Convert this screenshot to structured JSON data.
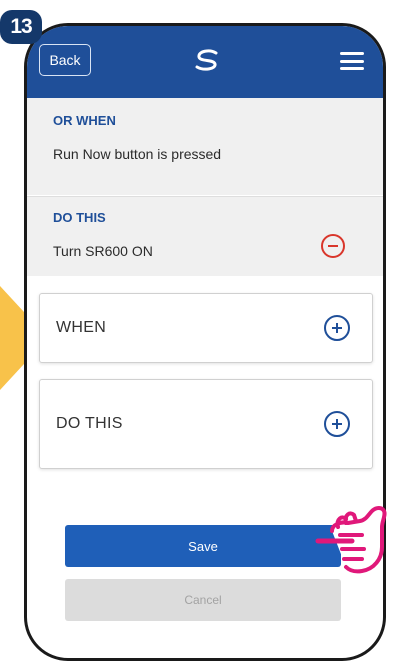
{
  "step_badge": "13",
  "header": {
    "back_label": "Back",
    "logo_icon": "salus-logo-icon",
    "menu_icon": "hamburger-menu-icon"
  },
  "or_when": {
    "heading": "OR WHEN",
    "text": "Run Now button is pressed"
  },
  "do_this_existing": {
    "heading": "DO THIS",
    "text": "Turn SR600 ON",
    "remove_icon": "minus-circle-icon"
  },
  "cards": [
    {
      "label": "WHEN",
      "icon": "plus-circle-icon"
    },
    {
      "label": "DO THIS",
      "icon": "plus-circle-icon"
    }
  ],
  "actions": {
    "save_label": "Save",
    "cancel_label": "Cancel"
  },
  "colors": {
    "header_bg": "#1f4f99",
    "accent_blue": "#1f4f99",
    "save_blue": "#1f5fb8",
    "remove_red": "#d9362b",
    "arrow_yellow": "#f8c24a",
    "hand_pink": "#e0187a"
  }
}
